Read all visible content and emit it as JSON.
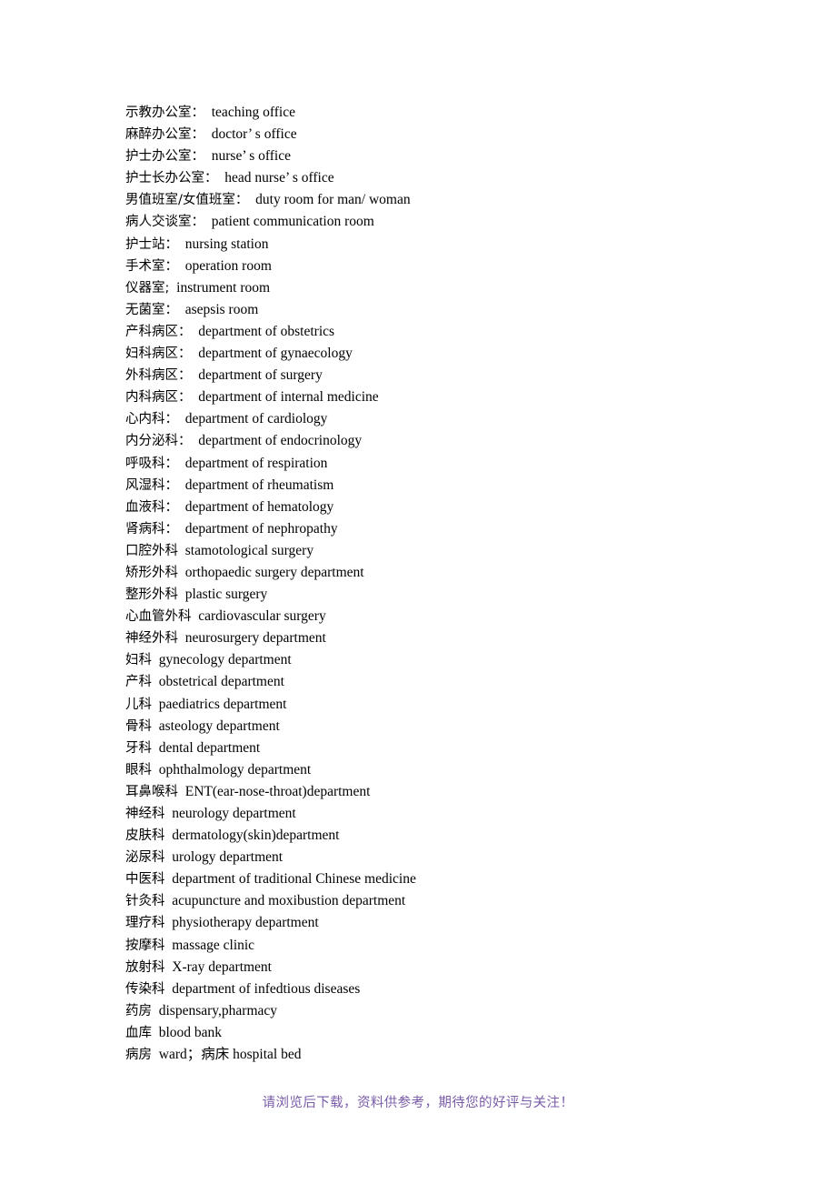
{
  "document": {
    "background_color": "#ffffff",
    "text_color": "#000000",
    "entries": [
      {
        "term": "示教办公室：",
        "translation": "teaching office"
      },
      {
        "term": "麻醉办公室：",
        "translation": "doctor’ s office"
      },
      {
        "term": "护士办公室：",
        "translation": "nurse’ s office"
      },
      {
        "term": "护士长办公室：",
        "translation": "head nurse’ s office"
      },
      {
        "term": "男值班室/女值班室：",
        "translation": "duty room for man/ woman"
      },
      {
        "term": "病人交谈室：",
        "translation": "patient communication room"
      },
      {
        "term": "护士站：",
        "translation": "nursing station"
      },
      {
        "term": "手术室：",
        "translation": "operation room"
      },
      {
        "term": "仪器室;",
        "translation": "instrument room"
      },
      {
        "term": "无菌室：",
        "translation": "asepsis room"
      },
      {
        "term": "产科病区：",
        "translation": "department of obstetrics"
      },
      {
        "term": "妇科病区：",
        "translation": "department of gynaecology"
      },
      {
        "term": "外科病区：",
        "translation": "department of surgery"
      },
      {
        "term": "内科病区：",
        "translation": "department of internal medicine"
      },
      {
        "term": "心内科：",
        "translation": "department of cardiology"
      },
      {
        "term": "内分泌科：",
        "translation": "department of endocrinology"
      },
      {
        "term": "呼吸科：",
        "translation": "department of respiration"
      },
      {
        "term": "风湿科：",
        "translation": "department of rheumatism"
      },
      {
        "term": "血液科：",
        "translation": "department of hematology"
      },
      {
        "term": "肾病科：",
        "translation": "department of nephropathy"
      },
      {
        "term": "口腔外科",
        "translation": "stamotological surgery"
      },
      {
        "term": "矫形外科",
        "translation": "orthopaedic surgery department"
      },
      {
        "term": "整形外科",
        "translation": "plastic surgery"
      },
      {
        "term": "心血管外科",
        "translation": "cardiovascular surgery"
      },
      {
        "term": "神经外科",
        "translation": "neurosurgery department"
      },
      {
        "term": "妇科",
        "translation": "gynecology department"
      },
      {
        "term": "产科",
        "translation": "obstetrical department"
      },
      {
        "term": "儿科",
        "translation": "paediatrics department"
      },
      {
        "term": "骨科",
        "translation": "asteology department"
      },
      {
        "term": "牙科",
        "translation": "dental department"
      },
      {
        "term": "眼科",
        "translation": "ophthalmology department"
      },
      {
        "term": "耳鼻喉科",
        "translation": "ENT(ear-nose-throat)department"
      },
      {
        "term": "神经科",
        "translation": "neurology department"
      },
      {
        "term": "皮肤科",
        "translation": "dermatology(skin)department"
      },
      {
        "term": "泌尿科",
        "translation": "urology department"
      },
      {
        "term": "中医科",
        "translation": "department of traditional Chinese medicine"
      },
      {
        "term": "针灸科",
        "translation": "acupuncture and moxibustion department"
      },
      {
        "term": "理疗科",
        "translation": "physiotherapy department"
      },
      {
        "term": "按摩科",
        "translation": "massage clinic"
      },
      {
        "term": "放射科",
        "translation": "X-ray department"
      },
      {
        "term": "传染科",
        "translation": "department of infedtious diseases"
      },
      {
        "term": "药房",
        "translation": "dispensary,pharmacy"
      },
      {
        "term": "血库",
        "translation": "blood bank"
      },
      {
        "term": "病房",
        "translation": "ward；病床 hospital bed"
      }
    ]
  },
  "footer": {
    "note": "请浏览后下载，资料供参考，期待您的好评与关注！",
    "color": "#7a5ca8"
  }
}
